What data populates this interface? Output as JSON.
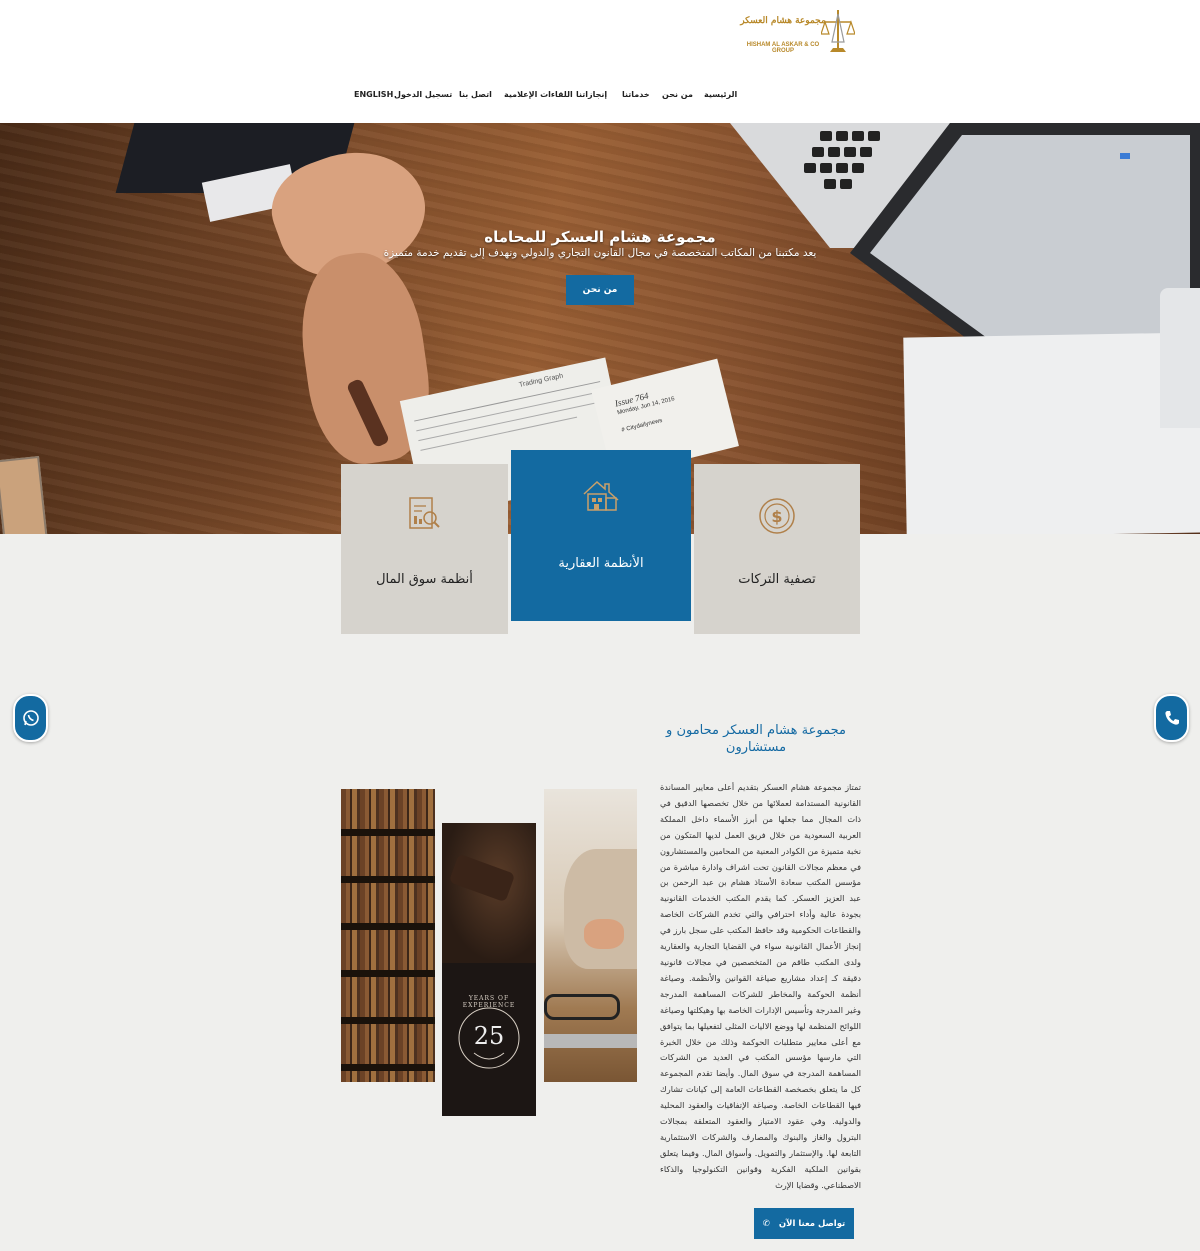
{
  "brand": {
    "logo_ar": "مجموعة هشام العسكر",
    "logo_en": "HISHAM AL ASKAR & CO GROUP"
  },
  "nav": {
    "items": [
      "الرئيسية",
      "من نحن",
      "خدماتنا",
      "إنجازاتنا",
      "اللقاءات الإعلامية",
      "اتصل بنا",
      "تسجيل الدخول",
      "ENGLISH"
    ]
  },
  "hero": {
    "title": "مجموعة هشام العسكر للمحاماه",
    "subtitle": "يعد مكتبنا من المكاتب المتخصصة في مجال القانون التجاري والدولي ونهدف إلى تقديم خدمة متميزة",
    "button": "من نحن",
    "paper_heading": "Trading Graph",
    "paper_issue": "Issue 764",
    "paper_date": "Monday, Jun 14, 2016",
    "paper_tag": "# Citydailynews"
  },
  "services": [
    {
      "label": "أنظمة سوق المال",
      "icon": "document-chart-icon"
    },
    {
      "label": "الأنظمة العقارية",
      "icon": "real-estate-icon"
    },
    {
      "label": "تصفية التركات",
      "icon": "dollar-coin-icon"
    }
  ],
  "about": {
    "title": "مجموعة هشام العسكر محامون و مستشارون",
    "body": "تمتاز مجموعة هشام العسكر بتقديم أعلى معايير المساندة القانونية المستدامة لعملائها من خلال تخصصها الدقيق في ذات المجال مما جعلها من أبرز الأسماء داخل المملكة العربية السعودية من خلال فريق العمل لديها المتكون من نخبة متميزة من الكوادر المعنية من المحامين والمستشارون في معظم مجالات القانون تحت اشراف وادارة مباشرة من مؤسس المكتب سعادة الأستاذ هشام بن عبد الرحمن بن عبد العزيز العسكر. كما يقدم المكتب الخدمات القانونية بجودة عالية وأداء احترافي والتي تخدم الشركات الخاصة والقطاعات الحكومية وقد حافظ المكتب على سجل بارز في إنجاز الأعمال القانونية سواء في القضايا التجارية والعقارية ولدى المكتب طاقم من المتخصصين في مجالات قانونية دقيقة كـ إعداد مشاريع صياغة القوانين والأنظمة. وصياغة أنظمة الحوكمة والمخاطر للشركات المساهمة المدرجة وغير المدرجة وتأسيس الإدارات الخاصة بها وهيكلتها وصياغة اللوائح المنظمة لها ووضع الاليات المثلى لتفعيلها بما يتوافق مع أعلى معايير متطلبات الحوكمة وذلك من خلال الخبرة التي مارسها مؤسس المكتب في العديد من الشركات المساهمة المدرجة في سوق المال. وأيضا تقدم المجموعة كل ما يتعلق بخصخصة القطاعات العامة إلى كيانات تشارك فيها القطاعات الخاصة. وصياغة الإتفاقيات والعقود المحلية والدولية. وفي عقود الامتياز والعقود المتعلقة بمجالات البترول والغاز والبنوك والمصارف والشركات الاستثمارية التابعة لها. والإستثمار والتمويل. وأسواق المال. وفيما يتعلق بقوانين الملكية الفكرية وقوانين التكنولوجيا والذكاء الاصطناعي. وقضايا الإرث",
    "badge_number": "25",
    "badge_text": "YEARS OF EXPERIENCE",
    "cta": "تواصل معنا الآن"
  },
  "floating": {
    "whatsapp": "whatsapp-icon",
    "phone": "phone-icon"
  },
  "colors": {
    "primary": "#136aa1",
    "gold": "#b8892a",
    "card_grey": "#d6d3cd",
    "bg": "#efefed"
  }
}
